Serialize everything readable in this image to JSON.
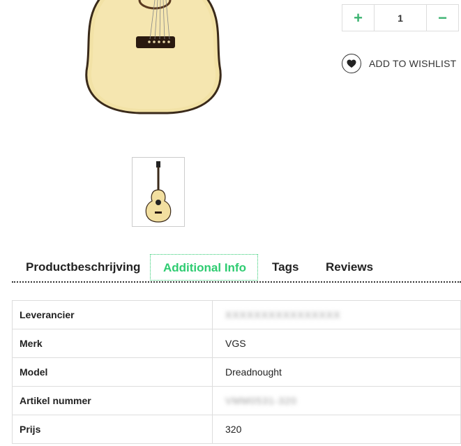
{
  "quantity": {
    "value": "1",
    "plus_label": "+",
    "minus_label": "−"
  },
  "wishlist": {
    "label": "ADD TO WISHLIST"
  },
  "tabs": [
    {
      "label": "Productbeschrijving",
      "active": false
    },
    {
      "label": "Additional Info",
      "active": true
    },
    {
      "label": "Tags",
      "active": false
    },
    {
      "label": "Reviews",
      "active": false
    }
  ],
  "info_table": [
    {
      "key": "Leverancier",
      "value": "XXXXXXXXXXXXXXXX"
    },
    {
      "key": "Merk",
      "value": "VGS"
    },
    {
      "key": "Model",
      "value": "Dreadnought"
    },
    {
      "key": "Artikel nummer",
      "value": "VMM0531-320"
    },
    {
      "key": "Prijs",
      "value": "320"
    }
  ],
  "colors": {
    "accent": "#2ecc71",
    "text": "#222222",
    "border": "#dddddd"
  }
}
